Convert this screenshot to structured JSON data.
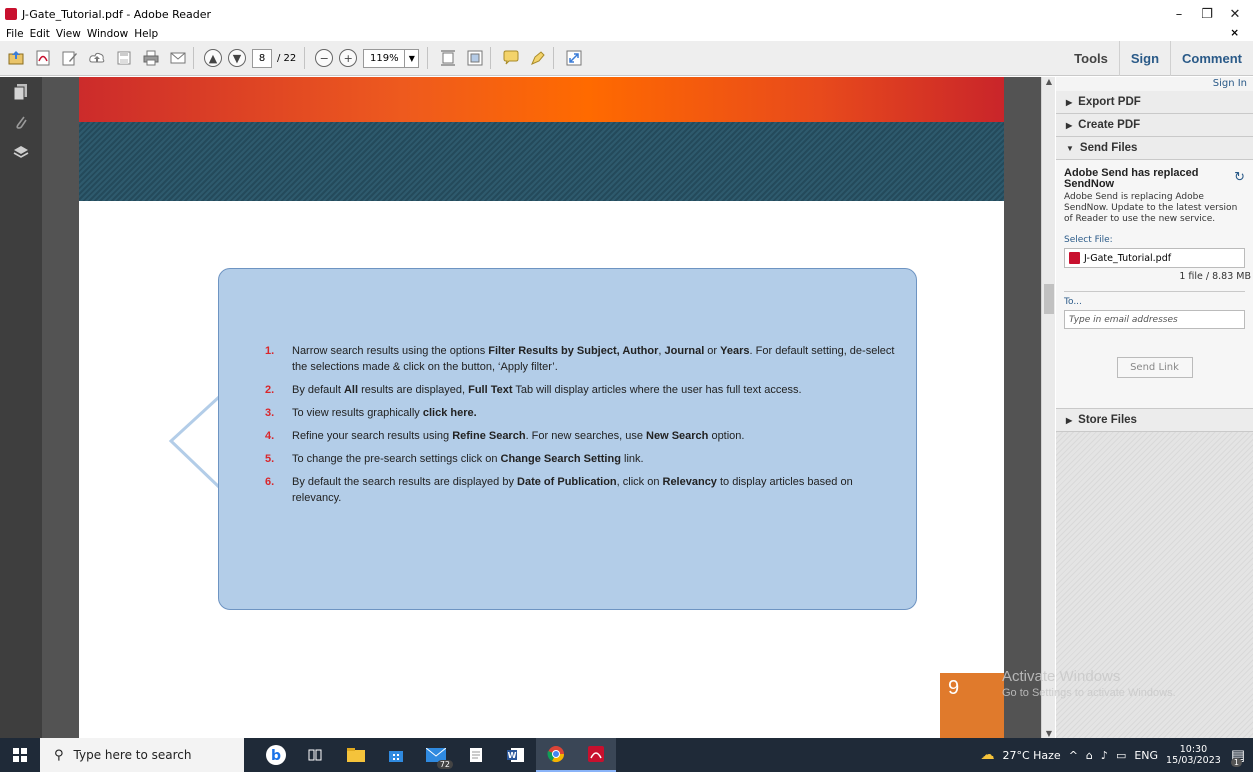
{
  "window": {
    "title": "J-Gate_Tutorial.pdf - Adobe Reader",
    "minimize": "–",
    "restore": "❐",
    "close": "✕"
  },
  "menu": {
    "items": [
      "File",
      "Edit",
      "View",
      "Window",
      "Help"
    ],
    "close_doc": "×"
  },
  "toolbar": {
    "page_current": "8",
    "page_total": "/ 22",
    "zoom": "119%",
    "tools": "Tools",
    "sign": "Sign",
    "comment": "Comment"
  },
  "document": {
    "items": [
      {
        "num": "1.",
        "html": "Narrow search results using the options <b>Filter Results by Subject, Author</b>, <b>Journal</b> or <b>Years</b>. For default setting, de-select the selections made & click on the button, ‘Apply filter’."
      },
      {
        "num": "2.",
        "html": "By default <b>All</b> results are displayed, <b>Full Text</b> Tab will display articles where the user has full text access."
      },
      {
        "num": "3.",
        "html": "To view results graphically <b>click here.</b>"
      },
      {
        "num": "4.",
        "html": "Refine your search results using <b>Refine Search</b>. For new searches, use <b>New Search</b> option."
      },
      {
        "num": "5.",
        "html": "To change the pre-search settings click on <b>Change Search Setting</b> link."
      },
      {
        "num": "6.",
        "html": "By default the search results are displayed by <b>Date of Publication</b>, click on <b>Relevancy</b> to display articles based on relevancy."
      }
    ],
    "page_number": "9"
  },
  "panel": {
    "sign_in": "Sign In",
    "export_pdf": "Export PDF",
    "create_pdf": "Create PDF",
    "send_files": "Send Files",
    "send_heading": "Adobe Send has replaced SendNow",
    "send_text": "Adobe Send is replacing Adobe SendNow. Update to the latest version of Reader to use the new service.",
    "select_file_label": "Select File:",
    "file_name": "J-Gate_Tutorial.pdf",
    "file_info": "1 file / 8.83 MB",
    "to_label": "To...",
    "email_placeholder": "Type in email addresses",
    "send_link": "Send Link",
    "store_files": "Store Files"
  },
  "watermark": {
    "line1": "Activate Windows",
    "line2": "Go to Settings to activate Windows."
  },
  "taskbar": {
    "search_placeholder": "Type here to search",
    "weather": "27°C  Haze",
    "lang": "ENG",
    "time": "10:30",
    "date": "15/03/2023",
    "mail_badge": "72",
    "notif_badge": "1"
  }
}
